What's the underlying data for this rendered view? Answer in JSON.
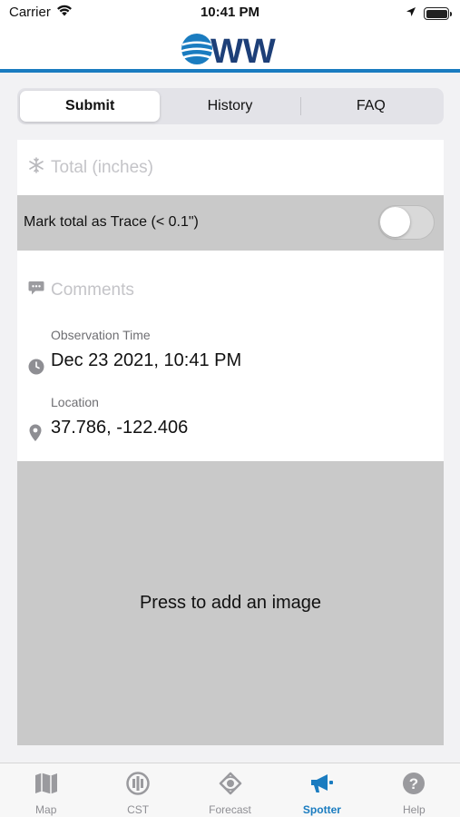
{
  "status_bar": {
    "carrier": "Carrier",
    "time": "10:41 PM"
  },
  "header": {
    "logo_text": "WW"
  },
  "segments": [
    {
      "label": "Submit",
      "active": true
    },
    {
      "label": "History",
      "active": false
    },
    {
      "label": "FAQ",
      "active": false
    }
  ],
  "form": {
    "total_placeholder": "Total (inches)",
    "trace_label": "Mark total as Trace (< 0.1\")",
    "trace_on": false,
    "comments_placeholder": "Comments",
    "observation_time_label": "Observation Time",
    "observation_time_value": "Dec 23 2021, 10:41 PM",
    "location_label": "Location",
    "location_value": "37.786, -122.406",
    "image_prompt": "Press to add an image"
  },
  "tabbar": {
    "items": [
      {
        "label": "Map",
        "icon": "map-icon",
        "active": false
      },
      {
        "label": "CST",
        "icon": "cst-icon",
        "active": false
      },
      {
        "label": "Forecast",
        "icon": "forecast-icon",
        "active": false
      },
      {
        "label": "Spotter",
        "icon": "megaphone-icon",
        "active": true
      },
      {
        "label": "Help",
        "icon": "help-icon",
        "active": false
      }
    ]
  },
  "colors": {
    "accent": "#1a7cc0",
    "logo_navy": "#1d3f78",
    "field_gray": "#c9c9c9"
  }
}
